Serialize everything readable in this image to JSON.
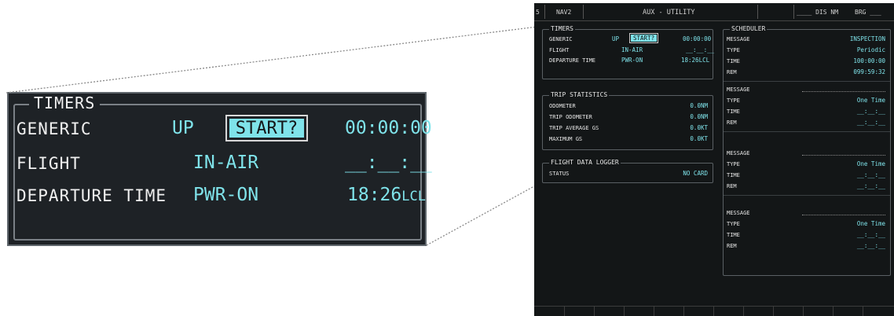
{
  "zoom": {
    "title": "TIMERS",
    "generic_label": "GENERIC",
    "generic_mode": "UP",
    "start_button": "START?",
    "generic_time": "00:00:00",
    "flight_label": "FLIGHT",
    "flight_mode": "IN-AIR",
    "flight_time": "__:__:__",
    "departure_label": "DEPARTURE TIME",
    "departure_mode": "PWR-ON",
    "departure_time": "18:26",
    "departure_suffix": "LCL"
  },
  "screen": {
    "page_num": "5",
    "nav_label": "NAV2",
    "title": "AUX - UTILITY",
    "dis_label": "DIS",
    "dis_value": "____",
    "dis_unit": "NM",
    "brg_label": "BRG",
    "brg_value": "___",
    "timers": {
      "title": "TIMERS",
      "generic_label": "GENERIC",
      "generic_mode": "UP",
      "start_button": "START?",
      "generic_time": "00:00:00",
      "flight_label": "FLIGHT",
      "flight_mode": "IN-AIR",
      "flight_time": "__:__:__",
      "departure_label": "DEPARTURE TIME",
      "departure_mode": "PWR-ON",
      "departure_time": "18:26LCL"
    },
    "trip": {
      "title": "TRIP STATISTICS",
      "rows": [
        {
          "label": "ODOMETER",
          "value": "0.0NM"
        },
        {
          "label": "TRIP ODOMETER",
          "value": "0.0NM"
        },
        {
          "label": "TRIP AVERAGE GS",
          "value": "0.0KT"
        },
        {
          "label": "MAXIMUM GS",
          "value": "0.0KT"
        }
      ]
    },
    "logger": {
      "title": "FLIGHT DATA LOGGER",
      "status_label": "STATUS",
      "status_value": "NO CARD"
    },
    "scheduler": {
      "title": "SCHEDULER",
      "blocks": [
        {
          "message_label": "MESSAGE",
          "message_value": "INSPECTION",
          "type_label": "TYPE",
          "type_value": "Periodic",
          "time_label": "TIME",
          "time_value": "100:00:00",
          "rem_label": "REM",
          "rem_value": "099:59:32"
        },
        {
          "message_label": "MESSAGE",
          "message_value": "",
          "type_label": "TYPE",
          "type_value": "One Time",
          "time_label": "TIME",
          "time_value": "__:__:__",
          "rem_label": "REM",
          "rem_value": "__:__:__"
        },
        {
          "message_label": "MESSAGE",
          "message_value": "",
          "type_label": "TYPE",
          "type_value": "One Time",
          "time_label": "TIME",
          "time_value": "__:__:__",
          "rem_label": "REM",
          "rem_value": "__:__:__"
        },
        {
          "message_label": "MESSAGE",
          "message_value": "",
          "type_label": "TYPE",
          "type_value": "One Time",
          "time_label": "TIME",
          "time_value": "__:__:__",
          "rem_label": "REM",
          "rem_value": "__:__:__"
        }
      ]
    }
  },
  "colors": {
    "cyan": "#7fe3ea",
    "panel": "#131617",
    "zoom_bg": "#1e2226"
  }
}
